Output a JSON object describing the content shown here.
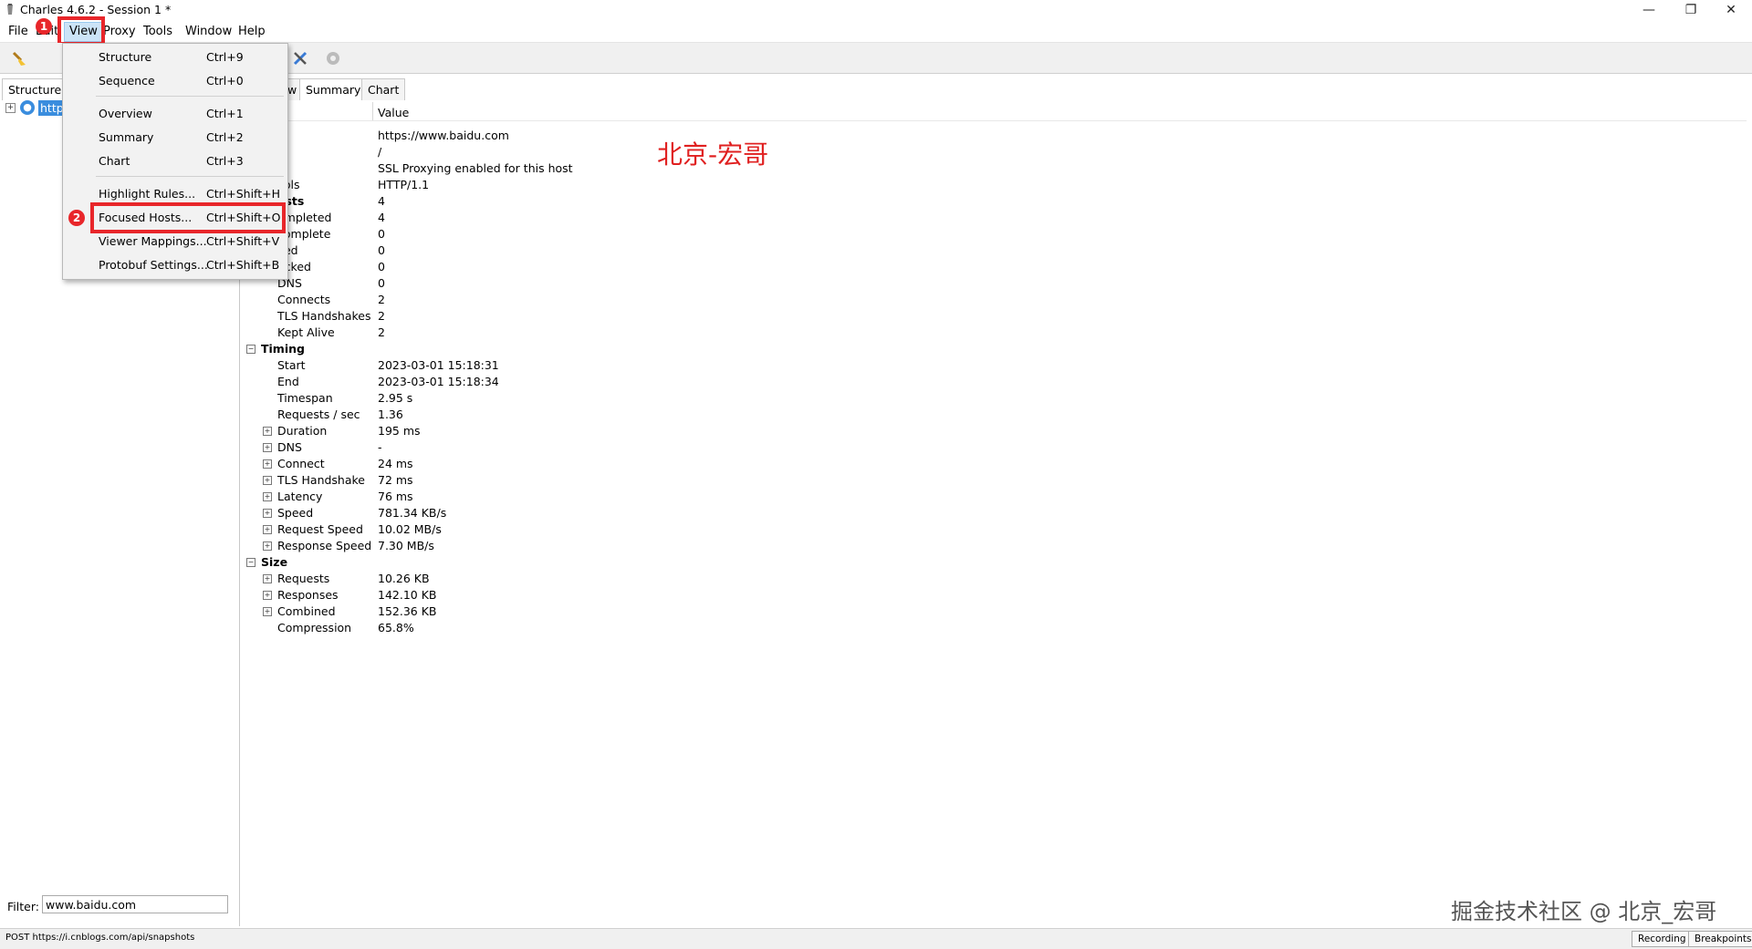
{
  "window": {
    "title": "Charles 4.6.2 - Session 1 *"
  },
  "menubar": {
    "items": [
      "File",
      "Edit",
      "View",
      "Proxy",
      "Tools",
      "Window",
      "Help"
    ]
  },
  "view_menu": {
    "items": [
      {
        "label": "Structure",
        "shortcut": "Ctrl+9"
      },
      {
        "label": "Sequence",
        "shortcut": "Ctrl+0"
      },
      {
        "label": "Overview",
        "shortcut": "Ctrl+1"
      },
      {
        "label": "Summary",
        "shortcut": "Ctrl+2"
      },
      {
        "label": "Chart",
        "shortcut": "Ctrl+3"
      },
      {
        "label": "Highlight Rules...",
        "shortcut": "Ctrl+Shift+H"
      },
      {
        "label": "Focused Hosts...",
        "shortcut": "Ctrl+Shift+O"
      },
      {
        "label": "Viewer Mappings...",
        "shortcut": "Ctrl+Shift+V"
      },
      {
        "label": "Protobuf Settings...",
        "shortcut": "Ctrl+Shift+B"
      }
    ]
  },
  "annotations": {
    "badge1": "1",
    "badge2": "2",
    "watermark_red": "北京-宏哥",
    "watermark_bottom": "掘金技术社区 @ 北京_宏哥"
  },
  "left_pane": {
    "tab": "Structure",
    "tree_item": "https",
    "filter_label": "Filter:",
    "filter_value": "www.baidu.com"
  },
  "right_pane": {
    "tabs": [
      "w",
      "Summary",
      "Chart"
    ],
    "value_header": "Value",
    "rows": [
      {
        "name": "",
        "value": "https://www.baidu.com"
      },
      {
        "name": "",
        "value": "/"
      },
      {
        "name": "s",
        "value": "SSL Proxying enabled for this host"
      },
      {
        "name": "cols",
        "value": "HTTP/1.1"
      },
      {
        "name": "ests",
        "value": "4"
      },
      {
        "name": "ompleted",
        "value": "4"
      },
      {
        "name": "complete",
        "value": "0"
      },
      {
        "name": "iled",
        "value": "0"
      },
      {
        "name": "ocked",
        "value": "0"
      },
      {
        "name": "DNS",
        "value": "0"
      },
      {
        "name": "Connects",
        "value": "2"
      },
      {
        "name": "TLS Handshakes",
        "value": "2"
      },
      {
        "name": "Kept Alive",
        "value": "2"
      },
      {
        "name": "Timing",
        "value": ""
      },
      {
        "name": "Start",
        "value": "2023-03-01 15:18:31"
      },
      {
        "name": "End",
        "value": "2023-03-01 15:18:34"
      },
      {
        "name": "Timespan",
        "value": "2.95 s"
      },
      {
        "name": "Requests / sec",
        "value": "1.36"
      },
      {
        "name": "Duration",
        "value": "195 ms"
      },
      {
        "name": "DNS",
        "value": "-"
      },
      {
        "name": "Connect",
        "value": "24 ms"
      },
      {
        "name": "TLS Handshake",
        "value": "72 ms"
      },
      {
        "name": "Latency",
        "value": "76 ms"
      },
      {
        "name": "Speed",
        "value": "781.34 KB/s"
      },
      {
        "name": "Request Speed",
        "value": "10.02 MB/s"
      },
      {
        "name": "Response Speed",
        "value": "7.30 MB/s"
      },
      {
        "name": "Size",
        "value": ""
      },
      {
        "name": "Requests",
        "value": "10.26 KB"
      },
      {
        "name": "Responses",
        "value": "142.10 KB"
      },
      {
        "name": "Combined",
        "value": "152.36 KB"
      },
      {
        "name": "Compression",
        "value": "65.8%"
      }
    ]
  },
  "statusbar": {
    "text": "POST https://i.cnblogs.com/api/snapshots",
    "recording": "Recording",
    "breakpoints": "Breakpoints"
  },
  "colors": {
    "accent_red": "#e8262a",
    "selection_blue": "#3a8dde"
  }
}
